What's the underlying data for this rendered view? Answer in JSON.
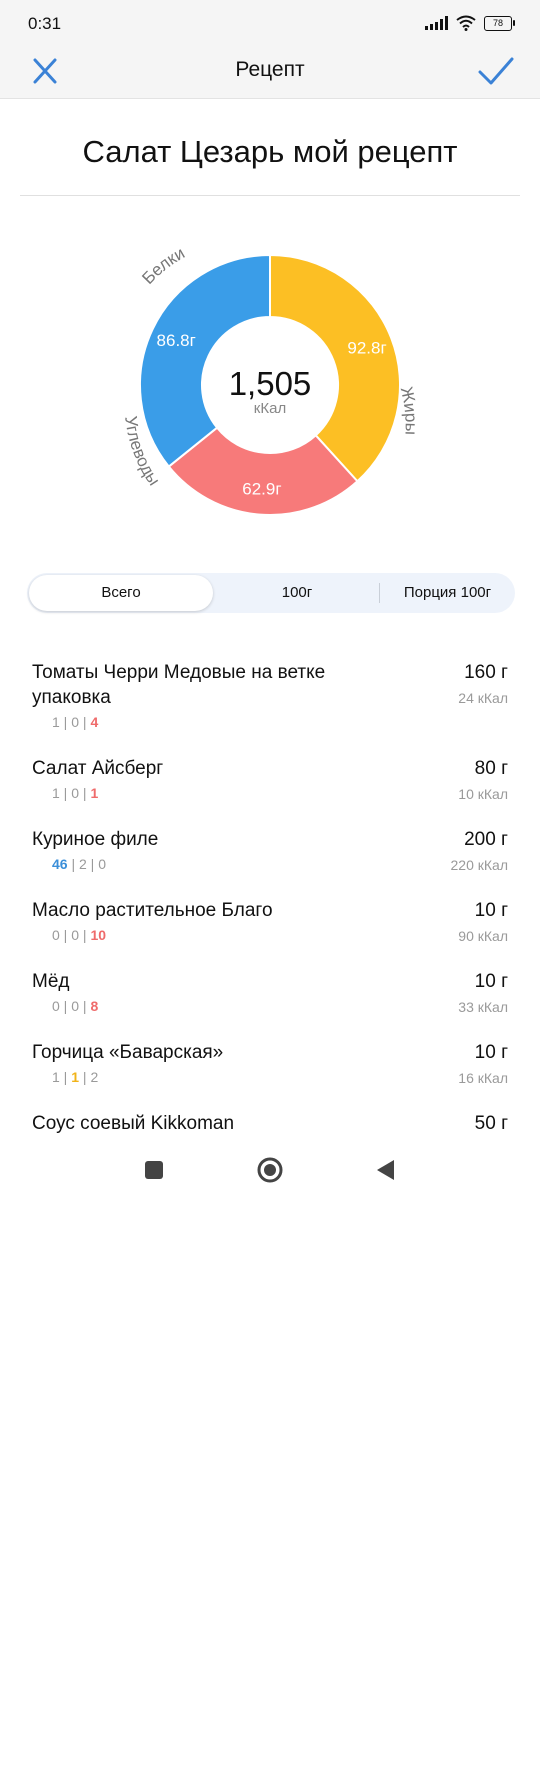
{
  "status": {
    "time": "0:31",
    "battery": "78"
  },
  "app_bar": {
    "title": "Рецепт"
  },
  "recipe": {
    "title": "Салат Цезарь мой рецепт"
  },
  "chart_data": {
    "type": "pie",
    "total": "1,505",
    "unit": "кКал",
    "slices": [
      {
        "label": "Белки",
        "value": 86.8,
        "display": "86.8г",
        "color": "#3a9de8"
      },
      {
        "label": "Жиры",
        "value": 92.8,
        "display": "92.8г",
        "color": "#fcbf24"
      },
      {
        "label": "Углеводы",
        "value": 62.9,
        "display": "62.9г",
        "color": "#f77a7a"
      }
    ]
  },
  "tabs": [
    {
      "label": "Всего",
      "active": true
    },
    {
      "label": "100г",
      "active": false
    },
    {
      "label": "Порция 100г",
      "active": false
    }
  ],
  "ingredients": [
    {
      "name": "Томаты Черри Медовые на ветке упаковка",
      "amount": "160 г",
      "kcal": "24 кКал",
      "p": "1",
      "f": "0",
      "c": "4",
      "hi": "c"
    },
    {
      "name": "Салат Айсберг",
      "amount": "80 г",
      "kcal": "10 кКал",
      "p": "1",
      "f": "0",
      "c": "1",
      "hi": "c"
    },
    {
      "name": "Куриное филе",
      "amount": "200 г",
      "kcal": "220 кКал",
      "p": "46",
      "f": "2",
      "c": "0",
      "hi": "p"
    },
    {
      "name": "Масло растительное Благо",
      "amount": "10 г",
      "kcal": "90 кКал",
      "p": "0",
      "f": "0",
      "c": "10",
      "hi": "c"
    },
    {
      "name": "Мёд",
      "amount": "10 г",
      "kcal": "33 кКал",
      "p": "0",
      "f": "0",
      "c": "8",
      "hi": "c"
    },
    {
      "name": "Горчица «Баварская»",
      "amount": "10 г",
      "kcal": "16 кКал",
      "p": "1",
      "f": "1",
      "c": "2",
      "hi": "f"
    },
    {
      "name": "Соус соевый Kikkoman",
      "amount": "50 г",
      "kcal": "",
      "p": "",
      "f": "",
      "c": "",
      "hi": ""
    }
  ],
  "icons": {
    "close": "close-icon",
    "confirm": "check-icon",
    "nav_recents": "square-icon",
    "nav_home": "circle-icon",
    "nav_back": "triangle-back-icon"
  },
  "colors": {
    "accent": "#3b82d6",
    "protein": "#3a9de8",
    "fat": "#fcbf24",
    "carbs": "#f77a7a"
  }
}
